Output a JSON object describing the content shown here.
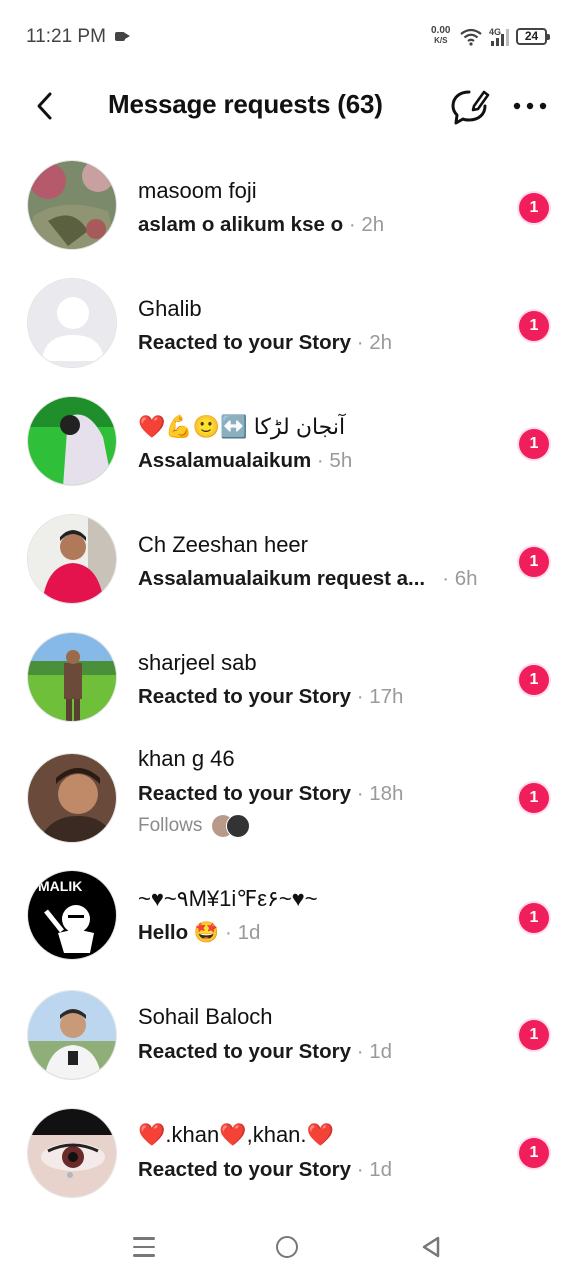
{
  "status": {
    "time": "11:21 PM",
    "net_speed_top": "0.00",
    "net_speed_bottom": "K/S",
    "signal_label": "4G",
    "battery": "24"
  },
  "header": {
    "title": "Message requests (63)"
  },
  "icons": {
    "back": "chevron-left-icon",
    "compose": "message-compose-icon",
    "more": "more-horizontal-icon"
  },
  "requests": [
    {
      "name": "masoom foji",
      "preview": "aslam o alikum kse o",
      "time": "· 2h",
      "badge": "1"
    },
    {
      "name": "Ghalib",
      "preview": "Reacted to your Story",
      "time": "· 2h",
      "badge": "1"
    },
    {
      "name": "❤️💪🙂↔️ آنجان لڑکا",
      "preview": "Assalamualaikum",
      "time": "· 5h",
      "badge": "1"
    },
    {
      "name": "Ch Zeeshan heer",
      "preview": "Assalamualaikum request a...",
      "time": "· 6h",
      "badge": "1"
    },
    {
      "name": "sharjeel sab",
      "preview": "Reacted to your Story",
      "time": "· 17h",
      "badge": "1"
    },
    {
      "name": "khan g 46",
      "preview": "Reacted to your Story",
      "time": "· 18h",
      "badge": "1",
      "follows": "Follows"
    },
    {
      "name": "~♥~٩M¥1i℉ε۶~♥~",
      "preview": "Hello 🤩",
      "time": "· 1d",
      "badge": "1",
      "avatar_text": "MALIK"
    },
    {
      "name": "Sohail Baloch",
      "preview": "Reacted to your Story",
      "time": "· 1d",
      "badge": "1"
    },
    {
      "name": "❤️.khan❤️,khan.❤️",
      "preview": "Reacted to your Story",
      "time": "· 1d",
      "badge": "1"
    }
  ],
  "colors": {
    "badge": "#f01e5a",
    "text": "#111111",
    "muted": "#9a9a9a"
  }
}
